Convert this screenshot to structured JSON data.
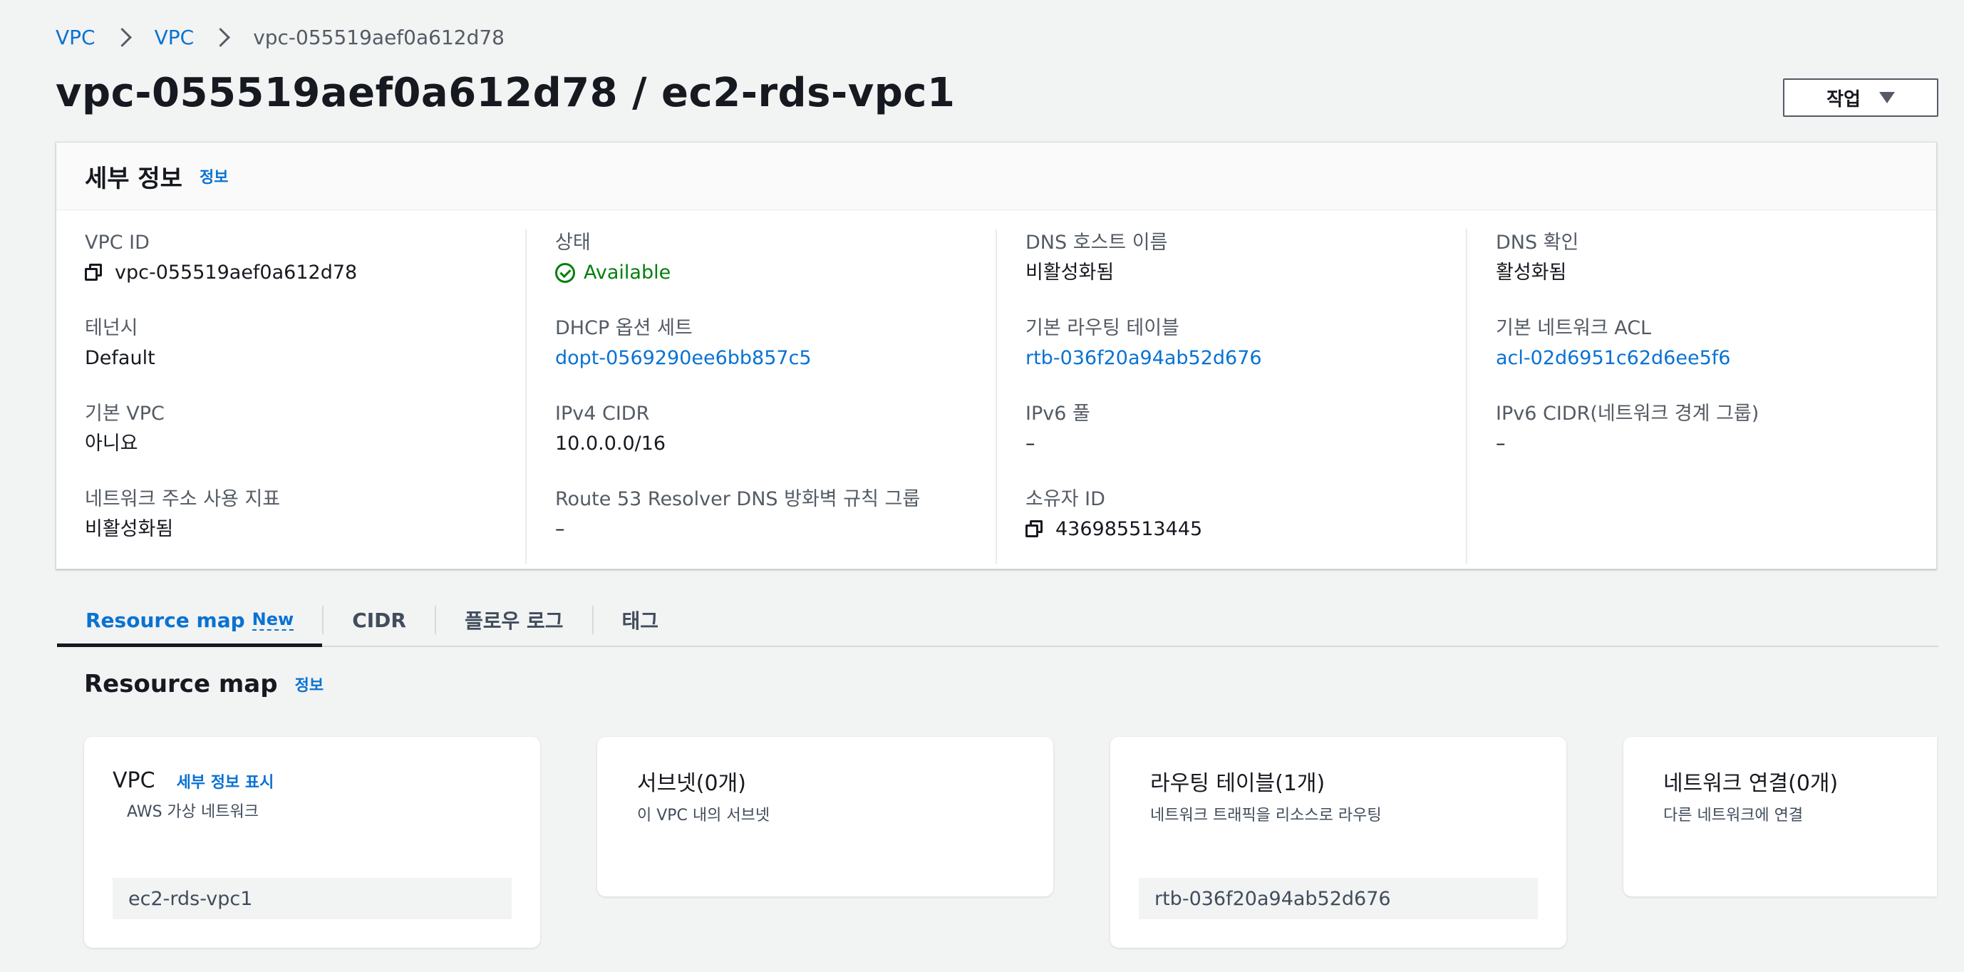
{
  "breadcrumb": {
    "items": [
      "VPC",
      "VPC",
      "vpc-055519aef0a612d78"
    ]
  },
  "header": {
    "title": "vpc-055519aef0a612d78 / ec2-rds-vpc1",
    "actions_label": "작업"
  },
  "details": {
    "title": "세부 정보",
    "info_label": "정보",
    "fields": {
      "vpc_id": {
        "label": "VPC ID",
        "value": "vpc-055519aef0a612d78"
      },
      "tenancy": {
        "label": "테넌시",
        "value": "Default"
      },
      "default_vpc": {
        "label": "기본 VPC",
        "value": "아니요"
      },
      "network_usage": {
        "label": "네트워크 주소 사용 지표",
        "value": "비활성화됨"
      },
      "state": {
        "label": "상태",
        "value": "Available"
      },
      "dhcp": {
        "label": "DHCP 옵션 세트",
        "value": "dopt-0569290ee6bb857c5"
      },
      "ipv4_cidr": {
        "label": "IPv4 CIDR",
        "value": "10.0.0.0/16"
      },
      "route53": {
        "label": "Route 53 Resolver DNS 방화벽 규칙 그룹",
        "value": "–"
      },
      "dns_hostnames": {
        "label": "DNS 호스트 이름",
        "value": "비활성화됨"
      },
      "main_route_table": {
        "label": "기본 라우팅 테이블",
        "value": "rtb-036f20a94ab52d676"
      },
      "ipv6_pool": {
        "label": "IPv6 풀",
        "value": "–"
      },
      "owner_id": {
        "label": "소유자 ID",
        "value": "436985513445"
      },
      "dns_resolution": {
        "label": "DNS 확인",
        "value": "활성화됨"
      },
      "main_network_acl": {
        "label": "기본 네트워크 ACL",
        "value": "acl-02d6951c62d6ee5f6"
      },
      "ipv6_cidr": {
        "label": "IPv6 CIDR(네트워크 경계 그룹)",
        "value": "–"
      }
    }
  },
  "tabs": {
    "resource_map": "Resource map",
    "new_badge": "New",
    "cidr": "CIDR",
    "flow_logs": "플로우 로그",
    "tags": "태그"
  },
  "resource_map": {
    "title": "Resource map",
    "info_label": "정보",
    "cards": {
      "vpc": {
        "title": "VPC",
        "details_link": "세부 정보 표시",
        "subtitle": "AWS 가상 네트워크",
        "item": "ec2-rds-vpc1"
      },
      "subnets": {
        "title": "서브넷(0개)",
        "subtitle": "이 VPC 내의 서브넷"
      },
      "route_tables": {
        "title": "라우팅 테이블(1개)",
        "subtitle": "네트워크 트래픽을 리소스로 라우팅",
        "item": "rtb-036f20a94ab52d676"
      },
      "network_connections": {
        "title": "네트워크 연결(0개)",
        "subtitle": "다른 네트워크에 연결"
      }
    }
  },
  "colors": {
    "link": "#0972d3",
    "success": "#037f0c",
    "text": "#16191f",
    "background": "#f2f3f3"
  },
  "icons": {
    "breadcrumb_separator": "chevron-right-icon",
    "actions": "caret-down-icon",
    "copy": "copy-icon",
    "status": "status-check-icon"
  }
}
